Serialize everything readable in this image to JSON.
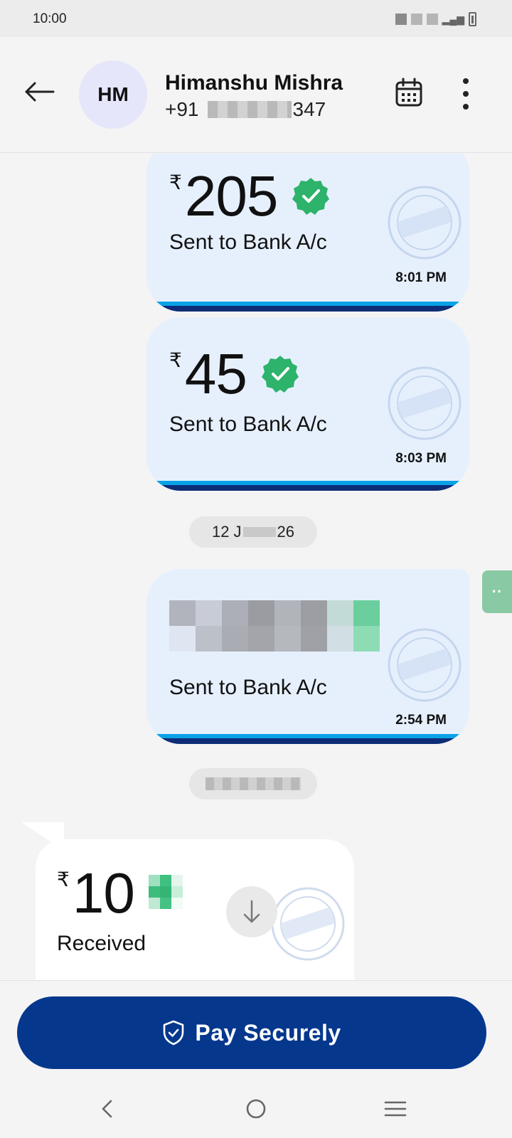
{
  "status_bar": {
    "time": "10:00"
  },
  "header": {
    "avatar_initials": "HM",
    "contact_name": "Himanshu Mishra",
    "phone_prefix": "+91",
    "phone_suffix": "347"
  },
  "messages": [
    {
      "currency": "₹",
      "amount": "205",
      "label": "Sent to Bank A/c",
      "time": "8:01 PM"
    },
    {
      "currency": "₹",
      "amount": "45",
      "label": "Sent to Bank A/c",
      "time": "8:03 PM"
    },
    {
      "label": "Sent to Bank A/c",
      "time": "2:54 PM"
    },
    {
      "currency": "₹",
      "amount": "10",
      "label": "Received"
    }
  ],
  "date_pills": [
    {
      "left": "12 J",
      "right": "26"
    }
  ],
  "footer": {
    "pay_label": "Pay Securely"
  },
  "colors": {
    "sent_bubble": "#e6f0fd",
    "pay_button": "#05378d",
    "verified_green": "#2db36b",
    "stripe_top": "#0aa2e6",
    "stripe_bottom": "#0e2d77"
  },
  "icons": {
    "back": "arrow-left-icon",
    "calendar": "calendar-icon",
    "more": "more-vertical-icon",
    "verified": "verified-badge-icon",
    "seal": "paytm-seal-icon",
    "download": "arrow-down-icon",
    "shield": "shield-check-icon"
  }
}
